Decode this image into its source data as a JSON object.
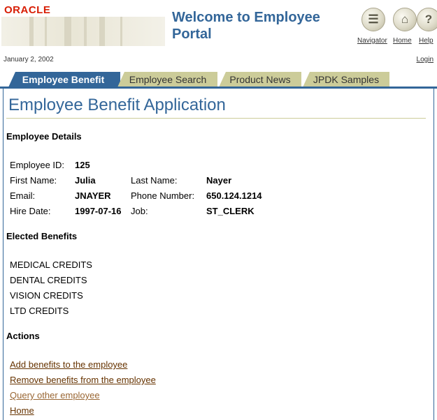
{
  "header": {
    "logo_text": "ORACLE",
    "title": "Welcome to Employee Portal",
    "global_links": [
      "Navigator",
      "Home",
      "Help"
    ],
    "date": "January 2, 2002",
    "login_label": "Login"
  },
  "tabs": [
    {
      "label": "Employee Benefit",
      "active": true
    },
    {
      "label": "Employee Search",
      "active": false
    },
    {
      "label": "Product News",
      "active": false
    },
    {
      "label": "JPDK Samples",
      "active": false
    }
  ],
  "page": {
    "title": "Employee Benefit Application",
    "details_heading": "Employee Details",
    "employee": {
      "id_label": "Employee ID:",
      "id": "125",
      "first_name_label": "First Name:",
      "first_name": "Julia",
      "last_name_label": "Last Name:",
      "last_name": "Nayer",
      "email_label": "Email:",
      "email": "JNAYER",
      "phone_label": "Phone Number:",
      "phone": "650.124.1214",
      "hire_date_label": "Hire Date:",
      "hire_date": "1997-07-16",
      "job_label": "Job:",
      "job": "ST_CLERK"
    },
    "benefits_heading": "Elected Benefits",
    "benefits": [
      "MEDICAL CREDITS",
      "DENTAL CREDITS",
      "VISION CREDITS",
      "LTD CREDITS"
    ],
    "actions_heading": "Actions",
    "actions": [
      "Add benefits to the employee",
      "Remove benefits from the employee",
      "Query other employee",
      "Home"
    ]
  },
  "colors": {
    "brand_blue": "#336699",
    "tab_tan": "#cccc99",
    "oracle_red": "#d81e05",
    "link_brown": "#663300"
  }
}
